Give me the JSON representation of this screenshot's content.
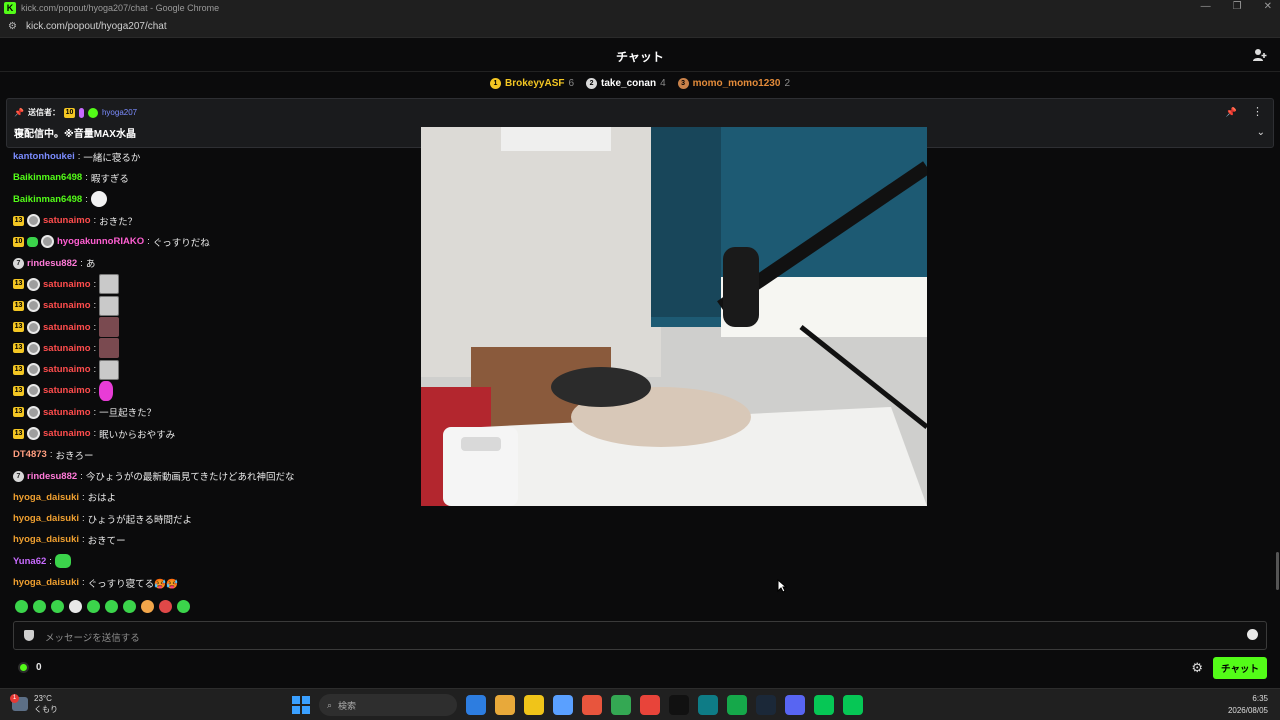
{
  "browser": {
    "window_title": "kick.com/popout/hyoga207/chat - Google Chrome",
    "url": "kick.com/popout/hyoga207/chat",
    "favicon_letter": "K"
  },
  "header": {
    "title": "チャット"
  },
  "leaderboard": [
    {
      "rank": "1",
      "name": "BrokeyyASF",
      "count": "6",
      "name_color": "#f3c623",
      "badge_color": "#f3c623"
    },
    {
      "rank": "2",
      "name": "take_conan",
      "count": "4",
      "name_color": "#ffffff",
      "badge_color": "#d9d9d9"
    },
    {
      "rank": "3",
      "name": "momo_momo1230",
      "count": "2",
      "name_color": "#e38b3a",
      "badge_color": "#c9824a"
    }
  ],
  "pinned": {
    "sender_label": "送信者：",
    "sub_months": "10",
    "username": "hyoga207",
    "message": "寝配信中。※音量MAX水晶"
  },
  "messages": [
    {
      "user": "kantonhoukei",
      "color": "#7b8cff",
      "text": "一緒に寝るか",
      "badges": []
    },
    {
      "user": "Baikinman6498",
      "color": "#53fc18",
      "text": "暇すぎる",
      "badges": []
    },
    {
      "user": "Baikinman6498",
      "color": "#53fc18",
      "text": "",
      "badges": [],
      "emote": "ghost"
    },
    {
      "user": "satunaimo",
      "color": "#ff4d4d",
      "text": "おきた？",
      "badges": [
        "13",
        "face"
      ]
    },
    {
      "user": "hyogakunnoRIAKO",
      "color": "#ff5fd2",
      "text": "ぐっすりだね",
      "badges": [
        "10",
        "green",
        "face"
      ]
    },
    {
      "user": "rindesu882",
      "color": "#ff7ad8",
      "text": "あ",
      "badges": [
        "7"
      ]
    },
    {
      "user": "satunaimo",
      "color": "#ff4d4d",
      "text": "",
      "badges": [
        "13",
        "face"
      ],
      "emote": "bw"
    },
    {
      "user": "satunaimo",
      "color": "#ff4d4d",
      "text": "",
      "badges": [
        "13",
        "face"
      ],
      "emote": "bw"
    },
    {
      "user": "satunaimo",
      "color": "#ff4d4d",
      "text": "",
      "badges": [
        "13",
        "face"
      ],
      "emote": "pink"
    },
    {
      "user": "satunaimo",
      "color": "#ff4d4d",
      "text": "",
      "badges": [
        "13",
        "face"
      ],
      "emote": "pink"
    },
    {
      "user": "satunaimo",
      "color": "#ff4d4d",
      "text": "",
      "badges": [
        "13",
        "face"
      ],
      "emote": "bw"
    },
    {
      "user": "satunaimo",
      "color": "#ff4d4d",
      "text": "",
      "badges": [
        "13",
        "face"
      ],
      "emote": "magenta"
    },
    {
      "user": "satunaimo",
      "color": "#ff4d4d",
      "text": "一旦起きた？",
      "badges": [
        "13",
        "face"
      ]
    },
    {
      "user": "satunaimo",
      "color": "#ff4d4d",
      "text": "眠いからおやすみ",
      "badges": [
        "13",
        "face"
      ]
    },
    {
      "user": "DT4873",
      "color": "#ff9e80",
      "text": "おきろー",
      "badges": []
    },
    {
      "user": "rindesu882",
      "color": "#ff7ad8",
      "text": "今ひょうがの最新動画見てきたけどあれ神回だな",
      "badges": [
        "7"
      ]
    },
    {
      "user": "hyoga_daisuki",
      "color": "#f0a030",
      "text": "おはよ",
      "badges": []
    },
    {
      "user": "hyoga_daisuki",
      "color": "#f0a030",
      "text": "ひょうが起きる時間だよ",
      "badges": []
    },
    {
      "user": "hyoga_daisuki",
      "color": "#f0a030",
      "text": "おきてー",
      "badges": []
    },
    {
      "user": "Yuna62",
      "color": "#c86bff",
      "text": "",
      "badges": [],
      "emote": "green"
    },
    {
      "user": "hyoga_daisuki",
      "color": "#f0a030",
      "text": "ぐっすり寝てる🥵🥵",
      "badges": []
    }
  ],
  "emote_bar": [
    "#3bd44b",
    "#3bd44b",
    "#3bd44b",
    "#e8e8e8",
    "#3bd44b",
    "#3bd44b",
    "#3bd44b",
    "#f3a64a",
    "#e04848",
    "#3bd44b"
  ],
  "input": {
    "placeholder": "メッセージを送信する"
  },
  "footer": {
    "points": "0",
    "send_label": "チャット"
  },
  "taskbar": {
    "temperature": "23°C",
    "weather_text": "くもり",
    "weather_alert": "1",
    "search_placeholder": "検索",
    "time": "6:35",
    "date": "2026/08/05",
    "app_icons": [
      "#2d7de0",
      "#e8a93a",
      "#f0c419",
      "#5aa0ff",
      "#e8553d",
      "#34a853",
      "#e8443a",
      "#111111",
      "#0e7c86",
      "#15a84a",
      "#1b2838",
      "#5865f2",
      "#06c755",
      "#06c755"
    ]
  },
  "colors": {
    "accent": "#53fc18",
    "background": "#0b0b0c"
  }
}
